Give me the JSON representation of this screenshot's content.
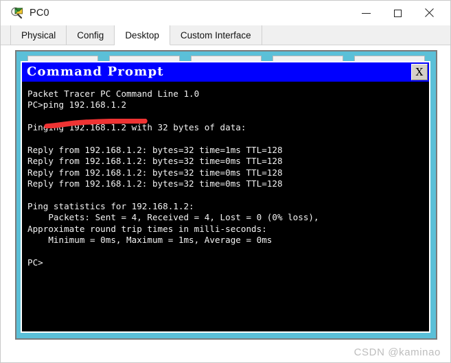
{
  "window": {
    "title": "PC0",
    "icon": "packet-tracer-inspect-icon",
    "controls": {
      "minimize": "—",
      "maximize": "□",
      "close": "✕"
    }
  },
  "tabs": [
    {
      "label": "Physical",
      "active": false
    },
    {
      "label": "Config",
      "active": false
    },
    {
      "label": "Desktop",
      "active": true
    },
    {
      "label": "Custom Interface",
      "active": false
    }
  ],
  "desktop": {
    "background_color": "#5bc0d8",
    "launcher_count": 5
  },
  "command_prompt": {
    "title": "Command Prompt",
    "close_label": "X",
    "titlebar_color": "#0000ff",
    "console_background": "#000000",
    "console_foreground": "#f2f2f2",
    "console_lines": [
      "Packet Tracer PC Command Line 1.0",
      "PC>ping 192.168.1.2",
      "",
      "Pinging 192.168.1.2 with 32 bytes of data:",
      "",
      "Reply from 192.168.1.2: bytes=32 time=1ms TTL=128",
      "Reply from 192.168.1.2: bytes=32 time=0ms TTL=128",
      "Reply from 192.168.1.2: bytes=32 time=0ms TTL=128",
      "Reply from 192.168.1.2: bytes=32 time=0ms TTL=128",
      "",
      "Ping statistics for 192.168.1.2:",
      "    Packets: Sent = 4, Received = 4, Lost = 0 (0% loss),",
      "Approximate round trip times in milli-seconds:",
      "    Minimum = 0ms, Maximum = 1ms, Average = 0ms",
      "",
      "PC>"
    ]
  },
  "annotation": {
    "type": "red-underline-stroke",
    "color": "#ef3333",
    "targets_line": "PC>ping 192.168.1.2"
  },
  "watermark": {
    "text": "CSDN @kaminao",
    "color": "#bdbdbd"
  }
}
